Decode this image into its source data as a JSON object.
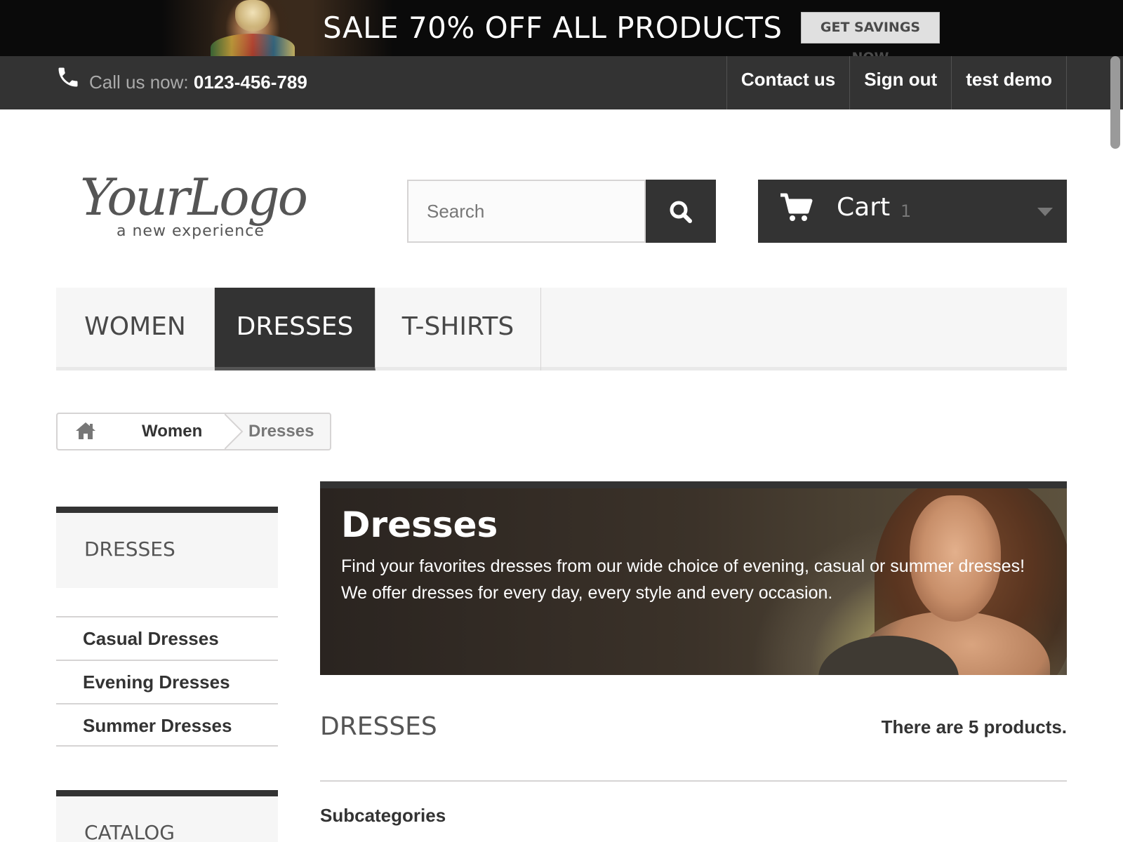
{
  "promo": {
    "text": "SALE 70% OFF ALL PRODUCTS",
    "button": "GET SAVINGS NOW"
  },
  "topbar": {
    "call_label": "Call us now:",
    "phone": "0123-456-789",
    "links": [
      "Contact us",
      "Sign out",
      "test demo"
    ]
  },
  "header": {
    "logo_text": "YourLogo",
    "logo_tagline": "a new experience",
    "search_placeholder": "Search",
    "cart_label": "Cart",
    "cart_count": "1"
  },
  "menu": {
    "items": [
      "WOMEN",
      "DRESSES",
      "T-SHIRTS"
    ],
    "active": "DRESSES"
  },
  "breadcrumb": {
    "items": [
      "Women",
      "Dresses"
    ]
  },
  "sidebar": {
    "block_title": "DRESSES",
    "categories": [
      "Casual Dresses",
      "Evening Dresses",
      "Summer Dresses"
    ],
    "catalog_title": "CATALOG"
  },
  "category": {
    "title": "Dresses",
    "description_line1": "Find your favorites dresses from our wide choice of evening, casual or summer dresses!",
    "description_line2": "We offer dresses for every day, every style and every occasion.",
    "heading": "DRESSES",
    "product_count": "There are 5 products.",
    "subcategories_heading": "Subcategories"
  },
  "colors": {
    "dark": "#333333",
    "light_bg": "#f6f6f6",
    "border": "#d6d4d4",
    "promo_bg": "#0a0a0a"
  },
  "icons": {
    "phone": "phone-icon",
    "search": "search-icon",
    "cart": "cart-icon",
    "home": "home-icon",
    "caret": "chevron-down-icon"
  }
}
